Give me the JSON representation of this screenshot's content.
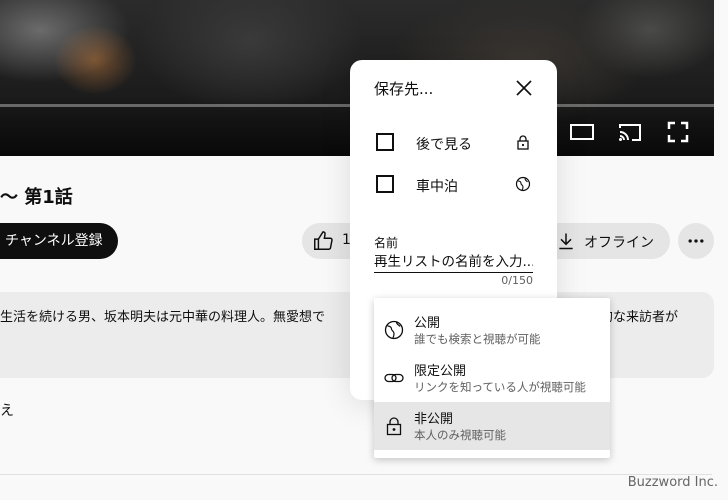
{
  "video_title": "〜 第1話",
  "channel": {
    "subscribe_label": "チャンネル登録"
  },
  "actions": {
    "like_count": "1",
    "offline_label": "オフライン"
  },
  "description": {
    "text_left": "生活を続ける男、坂本明夫は元中華の料理人。無愛想で",
    "text_right": "的な来訪者が"
  },
  "below_text": "え",
  "watermark": "Buzzword Inc.",
  "save_dialog": {
    "header": "保存先...",
    "playlists": [
      {
        "label": "後で見る",
        "checked": false,
        "privacy_icon": "lock-icon"
      },
      {
        "label": "車中泊",
        "checked": false,
        "privacy_icon": "globe-icon"
      }
    ],
    "name_label": "名前",
    "name_placeholder": "再生リストの名前を入力...",
    "name_counter": "0/150"
  },
  "privacy_menu": {
    "options": [
      {
        "title": "公開",
        "subtitle": "誰でも検索と視聴が可能",
        "icon": "globe-icon",
        "selected": false
      },
      {
        "title": "限定公開",
        "subtitle": "リンクを知っている人が視聴可能",
        "icon": "link-icon",
        "selected": false
      },
      {
        "title": "非公開",
        "subtitle": "本人のみ視聴可能",
        "icon": "lock-icon",
        "selected": true
      }
    ]
  }
}
